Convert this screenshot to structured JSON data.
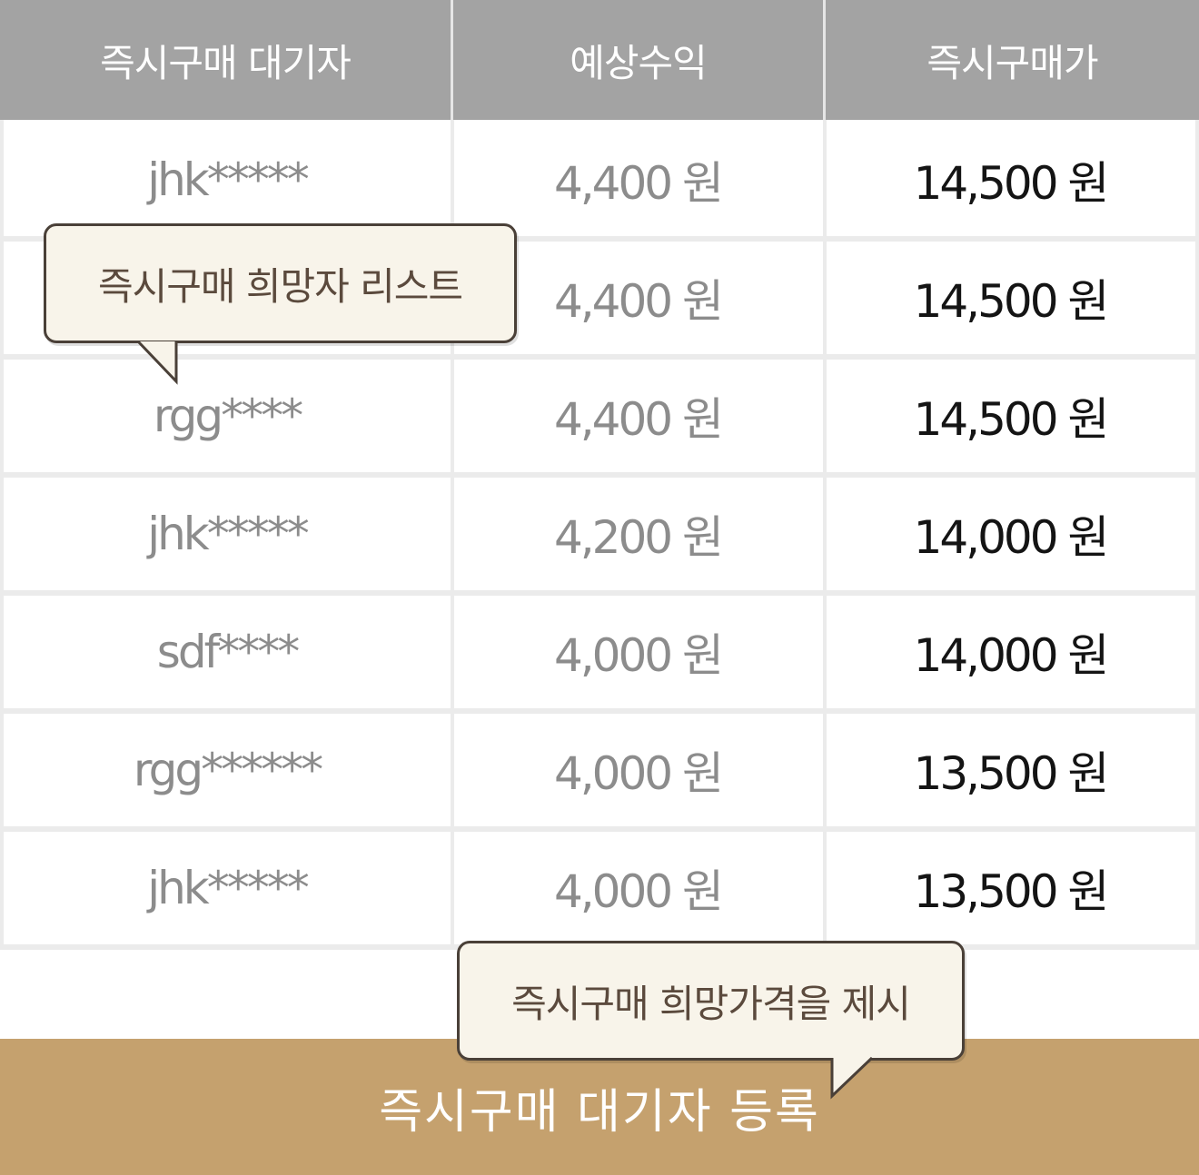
{
  "table": {
    "headers": [
      "즉시구매 대기자",
      "예상수익",
      "즉시구매가"
    ],
    "rows": [
      {
        "user": "jhk*****",
        "profit": "4,400 원",
        "price": "14,500 원"
      },
      {
        "user": "",
        "profit": "4,400 원",
        "price": "14,500 원"
      },
      {
        "user": "rgg****",
        "profit": "4,400 원",
        "price": "14,500 원"
      },
      {
        "user": "jhk*****",
        "profit": "4,200 원",
        "price": "14,000 원"
      },
      {
        "user": "sdf****",
        "profit": "4,000 원",
        "price": "14,000 원"
      },
      {
        "user": "rgg******",
        "profit": "4,000 원",
        "price": "13,500 원"
      },
      {
        "user": "jhk*****",
        "profit": "4,000 원",
        "price": "13,500 원"
      }
    ]
  },
  "tooltips": {
    "list": "즉시구매 희망자 리스트",
    "price": "즉시구매 희망가격을 제시"
  },
  "register_button": "즉시구매 대기자 등록",
  "colors": {
    "header_bg": "#a3a3a3",
    "button_bg": "#c5a16e",
    "tooltip_bg": "#f8f4ea",
    "tooltip_border": "#4a4038"
  }
}
